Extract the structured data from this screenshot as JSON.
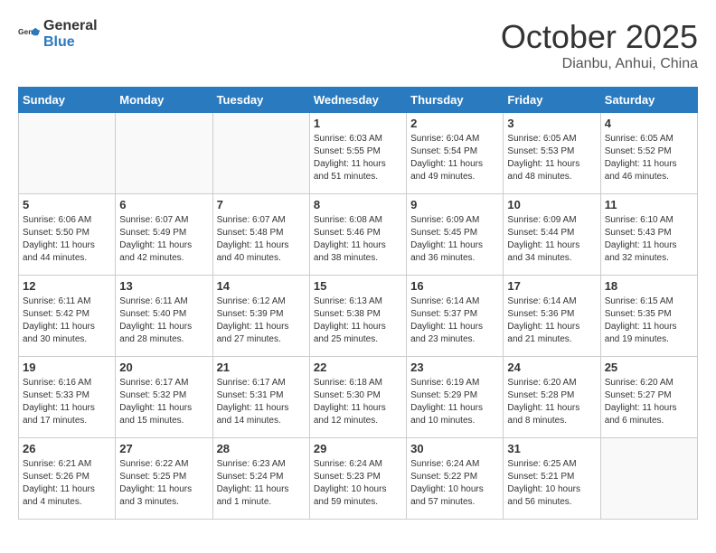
{
  "header": {
    "logo_general": "General",
    "logo_blue": "Blue",
    "month_year": "October 2025",
    "location": "Dianbu, Anhui, China"
  },
  "weekdays": [
    "Sunday",
    "Monday",
    "Tuesday",
    "Wednesday",
    "Thursday",
    "Friday",
    "Saturday"
  ],
  "weeks": [
    [
      {
        "day": "",
        "info": ""
      },
      {
        "day": "",
        "info": ""
      },
      {
        "day": "",
        "info": ""
      },
      {
        "day": "1",
        "info": "Sunrise: 6:03 AM\nSunset: 5:55 PM\nDaylight: 11 hours\nand 51 minutes."
      },
      {
        "day": "2",
        "info": "Sunrise: 6:04 AM\nSunset: 5:54 PM\nDaylight: 11 hours\nand 49 minutes."
      },
      {
        "day": "3",
        "info": "Sunrise: 6:05 AM\nSunset: 5:53 PM\nDaylight: 11 hours\nand 48 minutes."
      },
      {
        "day": "4",
        "info": "Sunrise: 6:05 AM\nSunset: 5:52 PM\nDaylight: 11 hours\nand 46 minutes."
      }
    ],
    [
      {
        "day": "5",
        "info": "Sunrise: 6:06 AM\nSunset: 5:50 PM\nDaylight: 11 hours\nand 44 minutes."
      },
      {
        "day": "6",
        "info": "Sunrise: 6:07 AM\nSunset: 5:49 PM\nDaylight: 11 hours\nand 42 minutes."
      },
      {
        "day": "7",
        "info": "Sunrise: 6:07 AM\nSunset: 5:48 PM\nDaylight: 11 hours\nand 40 minutes."
      },
      {
        "day": "8",
        "info": "Sunrise: 6:08 AM\nSunset: 5:46 PM\nDaylight: 11 hours\nand 38 minutes."
      },
      {
        "day": "9",
        "info": "Sunrise: 6:09 AM\nSunset: 5:45 PM\nDaylight: 11 hours\nand 36 minutes."
      },
      {
        "day": "10",
        "info": "Sunrise: 6:09 AM\nSunset: 5:44 PM\nDaylight: 11 hours\nand 34 minutes."
      },
      {
        "day": "11",
        "info": "Sunrise: 6:10 AM\nSunset: 5:43 PM\nDaylight: 11 hours\nand 32 minutes."
      }
    ],
    [
      {
        "day": "12",
        "info": "Sunrise: 6:11 AM\nSunset: 5:42 PM\nDaylight: 11 hours\nand 30 minutes."
      },
      {
        "day": "13",
        "info": "Sunrise: 6:11 AM\nSunset: 5:40 PM\nDaylight: 11 hours\nand 28 minutes."
      },
      {
        "day": "14",
        "info": "Sunrise: 6:12 AM\nSunset: 5:39 PM\nDaylight: 11 hours\nand 27 minutes."
      },
      {
        "day": "15",
        "info": "Sunrise: 6:13 AM\nSunset: 5:38 PM\nDaylight: 11 hours\nand 25 minutes."
      },
      {
        "day": "16",
        "info": "Sunrise: 6:14 AM\nSunset: 5:37 PM\nDaylight: 11 hours\nand 23 minutes."
      },
      {
        "day": "17",
        "info": "Sunrise: 6:14 AM\nSunset: 5:36 PM\nDaylight: 11 hours\nand 21 minutes."
      },
      {
        "day": "18",
        "info": "Sunrise: 6:15 AM\nSunset: 5:35 PM\nDaylight: 11 hours\nand 19 minutes."
      }
    ],
    [
      {
        "day": "19",
        "info": "Sunrise: 6:16 AM\nSunset: 5:33 PM\nDaylight: 11 hours\nand 17 minutes."
      },
      {
        "day": "20",
        "info": "Sunrise: 6:17 AM\nSunset: 5:32 PM\nDaylight: 11 hours\nand 15 minutes."
      },
      {
        "day": "21",
        "info": "Sunrise: 6:17 AM\nSunset: 5:31 PM\nDaylight: 11 hours\nand 14 minutes."
      },
      {
        "day": "22",
        "info": "Sunrise: 6:18 AM\nSunset: 5:30 PM\nDaylight: 11 hours\nand 12 minutes."
      },
      {
        "day": "23",
        "info": "Sunrise: 6:19 AM\nSunset: 5:29 PM\nDaylight: 11 hours\nand 10 minutes."
      },
      {
        "day": "24",
        "info": "Sunrise: 6:20 AM\nSunset: 5:28 PM\nDaylight: 11 hours\nand 8 minutes."
      },
      {
        "day": "25",
        "info": "Sunrise: 6:20 AM\nSunset: 5:27 PM\nDaylight: 11 hours\nand 6 minutes."
      }
    ],
    [
      {
        "day": "26",
        "info": "Sunrise: 6:21 AM\nSunset: 5:26 PM\nDaylight: 11 hours\nand 4 minutes."
      },
      {
        "day": "27",
        "info": "Sunrise: 6:22 AM\nSunset: 5:25 PM\nDaylight: 11 hours\nand 3 minutes."
      },
      {
        "day": "28",
        "info": "Sunrise: 6:23 AM\nSunset: 5:24 PM\nDaylight: 11 hours\nand 1 minute."
      },
      {
        "day": "29",
        "info": "Sunrise: 6:24 AM\nSunset: 5:23 PM\nDaylight: 10 hours\nand 59 minutes."
      },
      {
        "day": "30",
        "info": "Sunrise: 6:24 AM\nSunset: 5:22 PM\nDaylight: 10 hours\nand 57 minutes."
      },
      {
        "day": "31",
        "info": "Sunrise: 6:25 AM\nSunset: 5:21 PM\nDaylight: 10 hours\nand 56 minutes."
      },
      {
        "day": "",
        "info": ""
      }
    ]
  ]
}
